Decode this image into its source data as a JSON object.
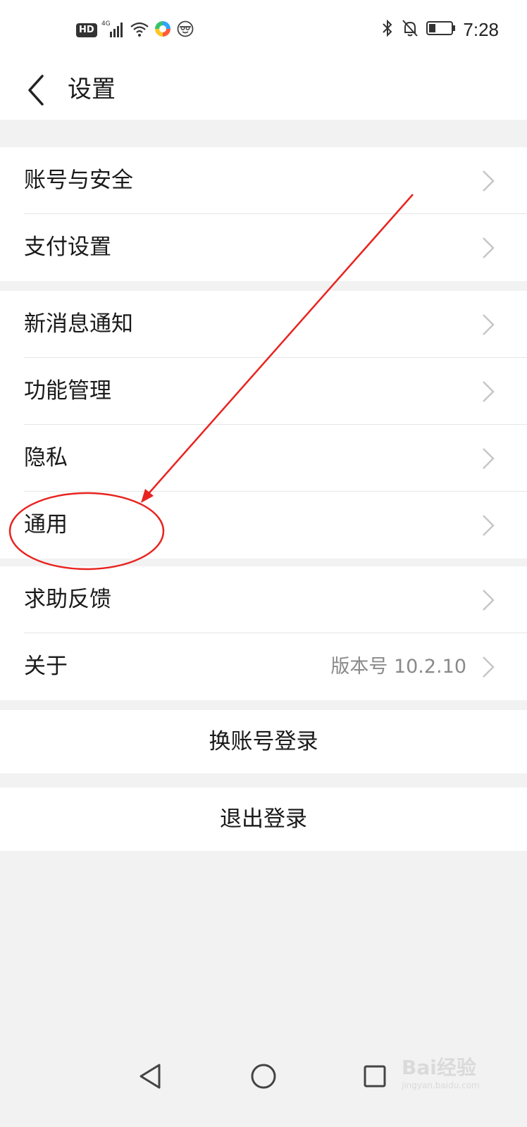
{
  "status_bar": {
    "network_badge": "HD",
    "network_type": "4G",
    "time": "7:28",
    "icons": [
      "hd-badge",
      "signal-icon",
      "wifi-icon",
      "app-notification-icon",
      "face-icon",
      "bluetooth-icon",
      "bell-off-icon",
      "battery-icon"
    ]
  },
  "header": {
    "title": "设置",
    "back_icon": "back-arrow-icon"
  },
  "groups": [
    {
      "items": [
        {
          "label": "账号与安全"
        },
        {
          "label": "支付设置"
        }
      ]
    },
    {
      "items": [
        {
          "label": "新消息通知"
        },
        {
          "label": "功能管理"
        },
        {
          "label": "隐私"
        },
        {
          "label": "通用"
        }
      ]
    },
    {
      "items": [
        {
          "label": "求助反馈"
        },
        {
          "label": "关于",
          "value": "版本号 10.2.10"
        }
      ]
    }
  ],
  "actions": {
    "switch_account": "换账号登录",
    "logout": "退出登录"
  },
  "navbar": {
    "icons": [
      "back-triangle-icon",
      "home-circle-icon",
      "recents-square-icon"
    ]
  },
  "watermark": {
    "logo": "Bai经验",
    "url": "jingyan.baidu.com"
  },
  "annotation": {
    "color": "#e8231f",
    "highlighted_item": "通用"
  }
}
